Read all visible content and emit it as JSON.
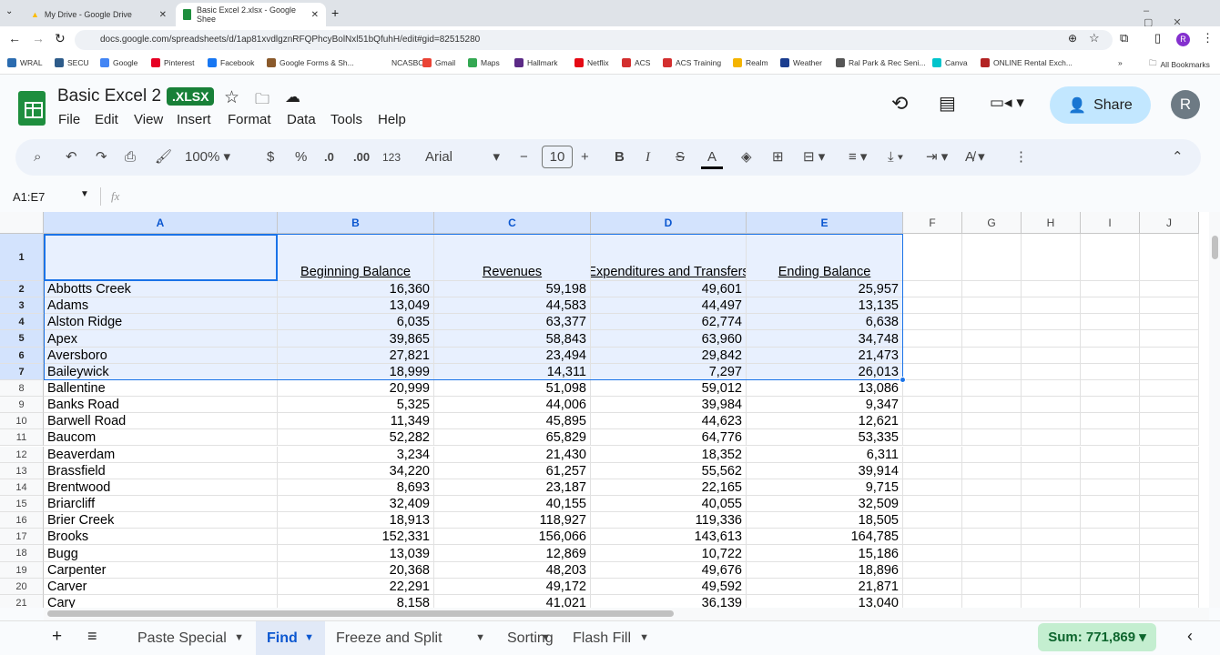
{
  "browser": {
    "tabs": [
      {
        "label": "My Drive - Google Drive",
        "active": false
      },
      {
        "label": "Basic Excel 2.xlsx - Google Shee",
        "active": true
      }
    ],
    "url": "docs.google.com/spreadsheets/d/1ap81xvdlgznRFQPhcyBolNxl51bQfuhH/edit#gid=82515280",
    "bookmarks": [
      "WRAL",
      "SECU",
      "Google",
      "Pinterest",
      "Facebook",
      "Google Forms & Sh...",
      "NCASBO",
      "Gmail",
      "Maps",
      "Hallmark",
      "Netflix",
      "ACS",
      "ACS Training",
      "Realm",
      "Weather",
      "Ral Park & Rec Seni...",
      "Canva",
      "ONLINE Rental Exch..."
    ],
    "all_bookmarks": "All Bookmarks"
  },
  "doc": {
    "title": "Basic Excel 2",
    "badge": ".XLSX",
    "menus": [
      "File",
      "Edit",
      "View",
      "Insert",
      "Format",
      "Data",
      "Tools",
      "Help"
    ],
    "share": "Share",
    "avatar": "R"
  },
  "toolbar": {
    "zoom": "100%",
    "currency": "$",
    "percent": "%",
    "dec_dec": ".0",
    "inc_dec": ".00",
    "format": "123",
    "font": "Arial",
    "font_size": "10",
    "bold": "B",
    "italic": "I",
    "strike": "S",
    "text_color": "A"
  },
  "formula_bar": {
    "name_box": "A1:E7",
    "fx": "fx",
    "value": ""
  },
  "columns": [
    "A",
    "B",
    "C",
    "D",
    "E",
    "F",
    "G",
    "H",
    "I",
    "J"
  ],
  "header_row": [
    "",
    "Beginning Balance",
    "Revenues",
    "Expenditures and Transfers",
    "Ending Balance"
  ],
  "rows": [
    [
      "Abbotts Creek",
      "16,360",
      "59,198",
      "49,601",
      "25,957"
    ],
    [
      "Adams",
      "13,049",
      "44,583",
      "44,497",
      "13,135"
    ],
    [
      "Alston Ridge",
      "6,035",
      "63,377",
      "62,774",
      "6,638"
    ],
    [
      "Apex",
      "39,865",
      "58,843",
      "63,960",
      "34,748"
    ],
    [
      "Aversboro",
      "27,821",
      "23,494",
      "29,842",
      "21,473"
    ],
    [
      "Baileywick",
      "18,999",
      "14,311",
      "7,297",
      "26,013"
    ],
    [
      "Ballentine",
      "20,999",
      "51,098",
      "59,012",
      "13,086"
    ],
    [
      "Banks Road",
      "5,325",
      "44,006",
      "39,984",
      "9,347"
    ],
    [
      "Barwell Road",
      "11,349",
      "45,895",
      "44,623",
      "12,621"
    ],
    [
      "Baucom",
      "52,282",
      "65,829",
      "64,776",
      "53,335"
    ],
    [
      "Beaverdam",
      "3,234",
      "21,430",
      "18,352",
      "6,311"
    ],
    [
      "Brassfield",
      "34,220",
      "61,257",
      "55,562",
      "39,914"
    ],
    [
      "Brentwood",
      "8,693",
      "23,187",
      "22,165",
      "9,715"
    ],
    [
      "Briarcliff",
      "32,409",
      "40,155",
      "40,055",
      "32,509"
    ],
    [
      "Brier Creek",
      "18,913",
      "118,927",
      "119,336",
      "18,505"
    ],
    [
      "Brooks",
      "152,331",
      "156,066",
      "143,613",
      "164,785"
    ],
    [
      "Bugg",
      "13,039",
      "12,869",
      "10,722",
      "15,186"
    ],
    [
      "Carpenter",
      "20,368",
      "48,203",
      "49,676",
      "18,896"
    ],
    [
      "Carver",
      "22,291",
      "49,172",
      "49,592",
      "21,871"
    ],
    [
      "Cary",
      "8,158",
      "41,021",
      "36,139",
      "13,040"
    ]
  ],
  "sheets": [
    {
      "label": "Paste Special",
      "active": false
    },
    {
      "label": "Find",
      "active": true
    },
    {
      "label": "Freeze and Split",
      "active": false
    },
    {
      "label": "Sorting",
      "active": false
    },
    {
      "label": "Flash Fill",
      "active": false
    }
  ],
  "status": {
    "sum": "Sum: 771,869"
  },
  "colors": {
    "accent": "#1a73e8",
    "selection": "#e8f0fe",
    "share": "#c2e7ff",
    "sum": "#c4eed0",
    "sheets_green": "#1e8e3e"
  }
}
